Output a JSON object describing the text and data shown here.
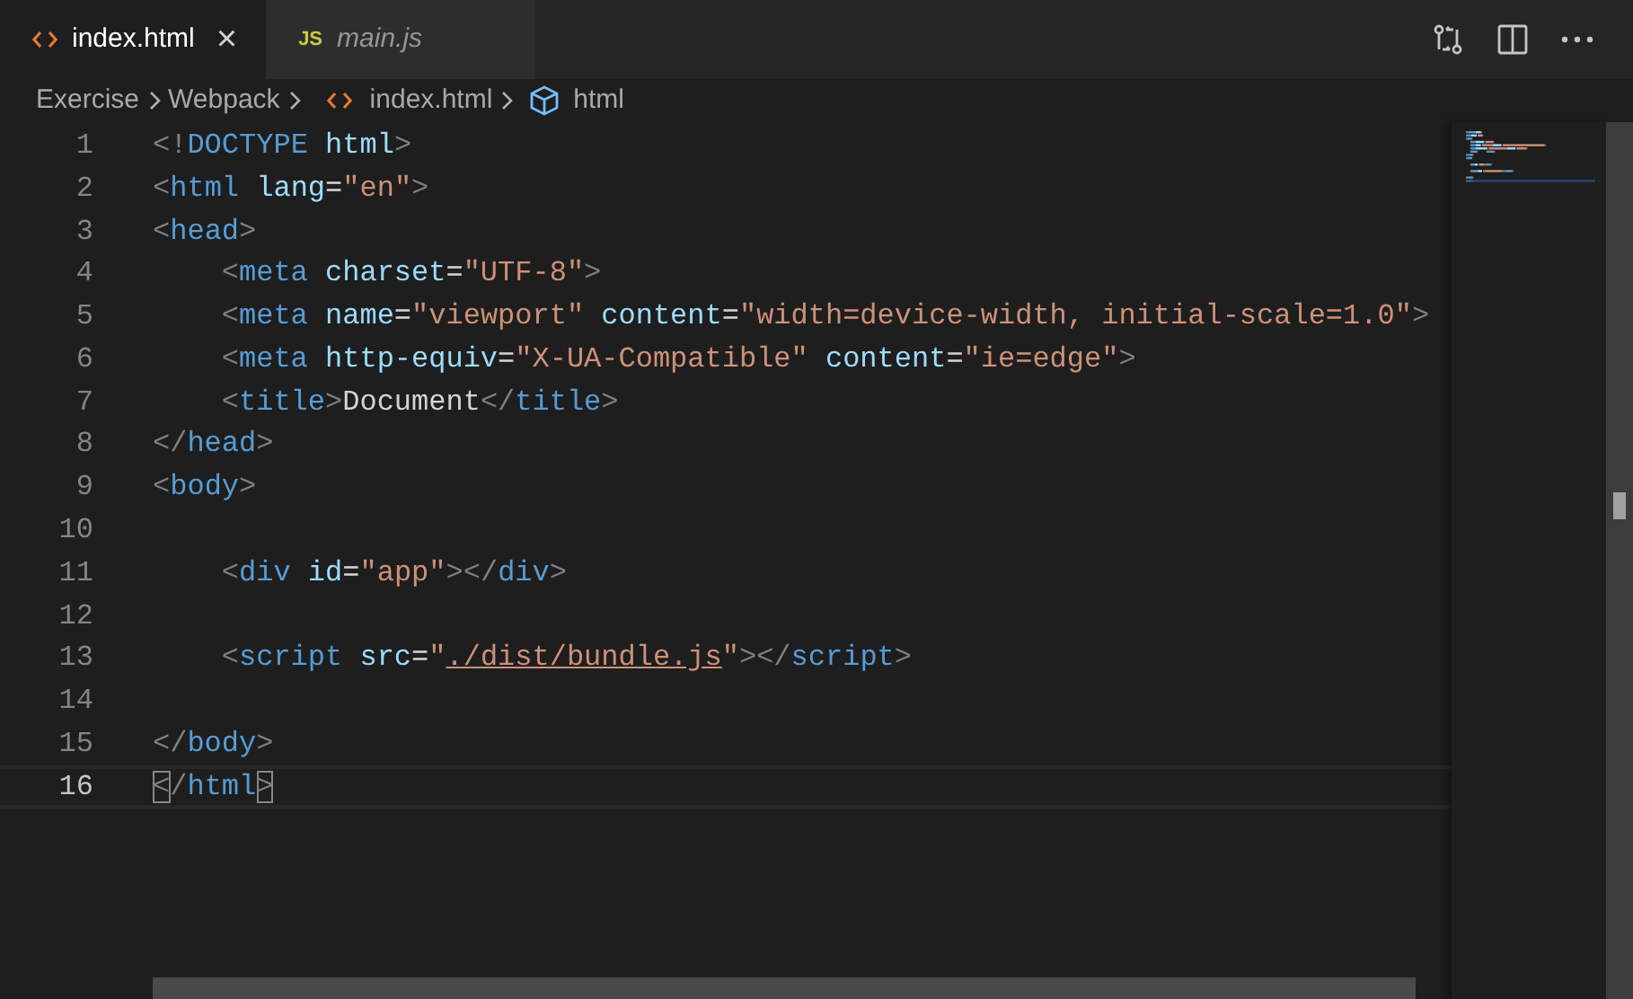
{
  "tabs": [
    {
      "kind": "html",
      "label": "index.html",
      "selected": true,
      "preview": false,
      "close": "×"
    },
    {
      "kind": "js",
      "icon_text": "JS",
      "label": "main.js",
      "selected": false,
      "preview": true
    }
  ],
  "breadcrumb": [
    {
      "kind": "folder",
      "label": "Exercise"
    },
    {
      "kind": "folder",
      "label": "Webpack"
    },
    {
      "kind": "html",
      "label": "index.html"
    },
    {
      "kind": "element",
      "label": "html"
    }
  ],
  "editor": {
    "lines": [
      {
        "number": "1",
        "indented": false,
        "current": false,
        "segments": [
          {
            "kind": "punct",
            "text": "<!"
          },
          {
            "kind": "tag",
            "text": "DOCTYPE"
          },
          {
            "kind": "attr",
            "text": " html"
          },
          {
            "kind": "punct",
            "text": ">"
          }
        ]
      },
      {
        "number": "2",
        "indented": false,
        "current": false,
        "segments": [
          {
            "kind": "punct",
            "text": "<"
          },
          {
            "kind": "tag",
            "text": "html"
          },
          {
            "kind": "attr",
            "text": " lang"
          },
          {
            "kind": "text",
            "text": "="
          },
          {
            "kind": "str",
            "text": "\"en\""
          },
          {
            "kind": "punct",
            "text": ">"
          }
        ]
      },
      {
        "number": "3",
        "indented": false,
        "current": false,
        "segments": [
          {
            "kind": "punct",
            "text": "<"
          },
          {
            "kind": "tag",
            "text": "head"
          },
          {
            "kind": "punct",
            "text": ">"
          }
        ]
      },
      {
        "number": "4",
        "indented": true,
        "current": false,
        "segments": [
          {
            "kind": "punct",
            "text": "<"
          },
          {
            "kind": "tag",
            "text": "meta"
          },
          {
            "kind": "attr",
            "text": " charset"
          },
          {
            "kind": "text",
            "text": "="
          },
          {
            "kind": "str",
            "text": "\"UTF-8\""
          },
          {
            "kind": "punct",
            "text": ">"
          }
        ]
      },
      {
        "number": "5",
        "indented": true,
        "current": false,
        "segments": [
          {
            "kind": "punct",
            "text": "<"
          },
          {
            "kind": "tag",
            "text": "meta"
          },
          {
            "kind": "attr",
            "text": " name"
          },
          {
            "kind": "text",
            "text": "="
          },
          {
            "kind": "str",
            "text": "\"viewport\""
          },
          {
            "kind": "attr",
            "text": " content"
          },
          {
            "kind": "text",
            "text": "="
          },
          {
            "kind": "str",
            "text": "\"width=device-width, initial-scale=1.0\""
          },
          {
            "kind": "punct",
            "text": ">"
          }
        ]
      },
      {
        "number": "6",
        "indented": true,
        "current": false,
        "segments": [
          {
            "kind": "punct",
            "text": "<"
          },
          {
            "kind": "tag",
            "text": "meta"
          },
          {
            "kind": "attr",
            "text": " http-equiv"
          },
          {
            "kind": "text",
            "text": "="
          },
          {
            "kind": "str",
            "text": "\"X-UA-Compatible\""
          },
          {
            "kind": "attr",
            "text": " content"
          },
          {
            "kind": "text",
            "text": "="
          },
          {
            "kind": "str",
            "text": "\"ie=edge\""
          },
          {
            "kind": "punct",
            "text": ">"
          }
        ]
      },
      {
        "number": "7",
        "indented": true,
        "current": false,
        "segments": [
          {
            "kind": "punct",
            "text": "<"
          },
          {
            "kind": "tag",
            "text": "title"
          },
          {
            "kind": "punct",
            "text": ">"
          },
          {
            "kind": "text",
            "text": "Document"
          },
          {
            "kind": "punct",
            "text": "</"
          },
          {
            "kind": "tag",
            "text": "title"
          },
          {
            "kind": "punct",
            "text": ">"
          }
        ]
      },
      {
        "number": "8",
        "indented": false,
        "current": false,
        "segments": [
          {
            "kind": "punct",
            "text": "</"
          },
          {
            "kind": "tag",
            "text": "head"
          },
          {
            "kind": "punct",
            "text": ">"
          }
        ]
      },
      {
        "number": "9",
        "indented": false,
        "current": false,
        "segments": [
          {
            "kind": "punct",
            "text": "<"
          },
          {
            "kind": "tag",
            "text": "body"
          },
          {
            "kind": "punct",
            "text": ">"
          }
        ]
      },
      {
        "number": "10",
        "current": false
      },
      {
        "number": "11",
        "indented": true,
        "current": false,
        "segments": [
          {
            "kind": "punct",
            "text": "<"
          },
          {
            "kind": "tag",
            "text": "div"
          },
          {
            "kind": "attr",
            "text": " id"
          },
          {
            "kind": "text",
            "text": "="
          },
          {
            "kind": "str",
            "text": "\"app\""
          },
          {
            "kind": "punct",
            "text": "></"
          },
          {
            "kind": "tag",
            "text": "div"
          },
          {
            "kind": "punct",
            "text": ">"
          }
        ]
      },
      {
        "number": "12",
        "current": false
      },
      {
        "number": "13",
        "indented": true,
        "current": false,
        "segments": [
          {
            "kind": "punct",
            "text": "<"
          },
          {
            "kind": "tag",
            "text": "script"
          },
          {
            "kind": "attr",
            "text": " src"
          },
          {
            "kind": "text",
            "text": "="
          },
          {
            "kind": "str",
            "text": "\""
          },
          {
            "kind": "link",
            "text": "./dist/bundle.js"
          },
          {
            "kind": "str",
            "text": "\""
          },
          {
            "kind": "punct",
            "text": "></"
          },
          {
            "kind": "tag",
            "text": "script"
          },
          {
            "kind": "punct",
            "text": ">"
          }
        ]
      },
      {
        "number": "14",
        "current": false
      },
      {
        "number": "15",
        "indented": false,
        "current": false,
        "segments": [
          {
            "kind": "punct",
            "text": "</"
          },
          {
            "kind": "tag",
            "text": "body"
          },
          {
            "kind": "punct",
            "text": ">"
          }
        ]
      },
      {
        "number": "16",
        "indented": false,
        "current": true,
        "segments": [
          {
            "kind": "bracket",
            "text": "<"
          },
          {
            "kind": "punct",
            "text": "/"
          },
          {
            "kind": "tag",
            "text": "html"
          },
          {
            "kind": "bracket",
            "text": ">"
          }
        ]
      }
    ]
  }
}
